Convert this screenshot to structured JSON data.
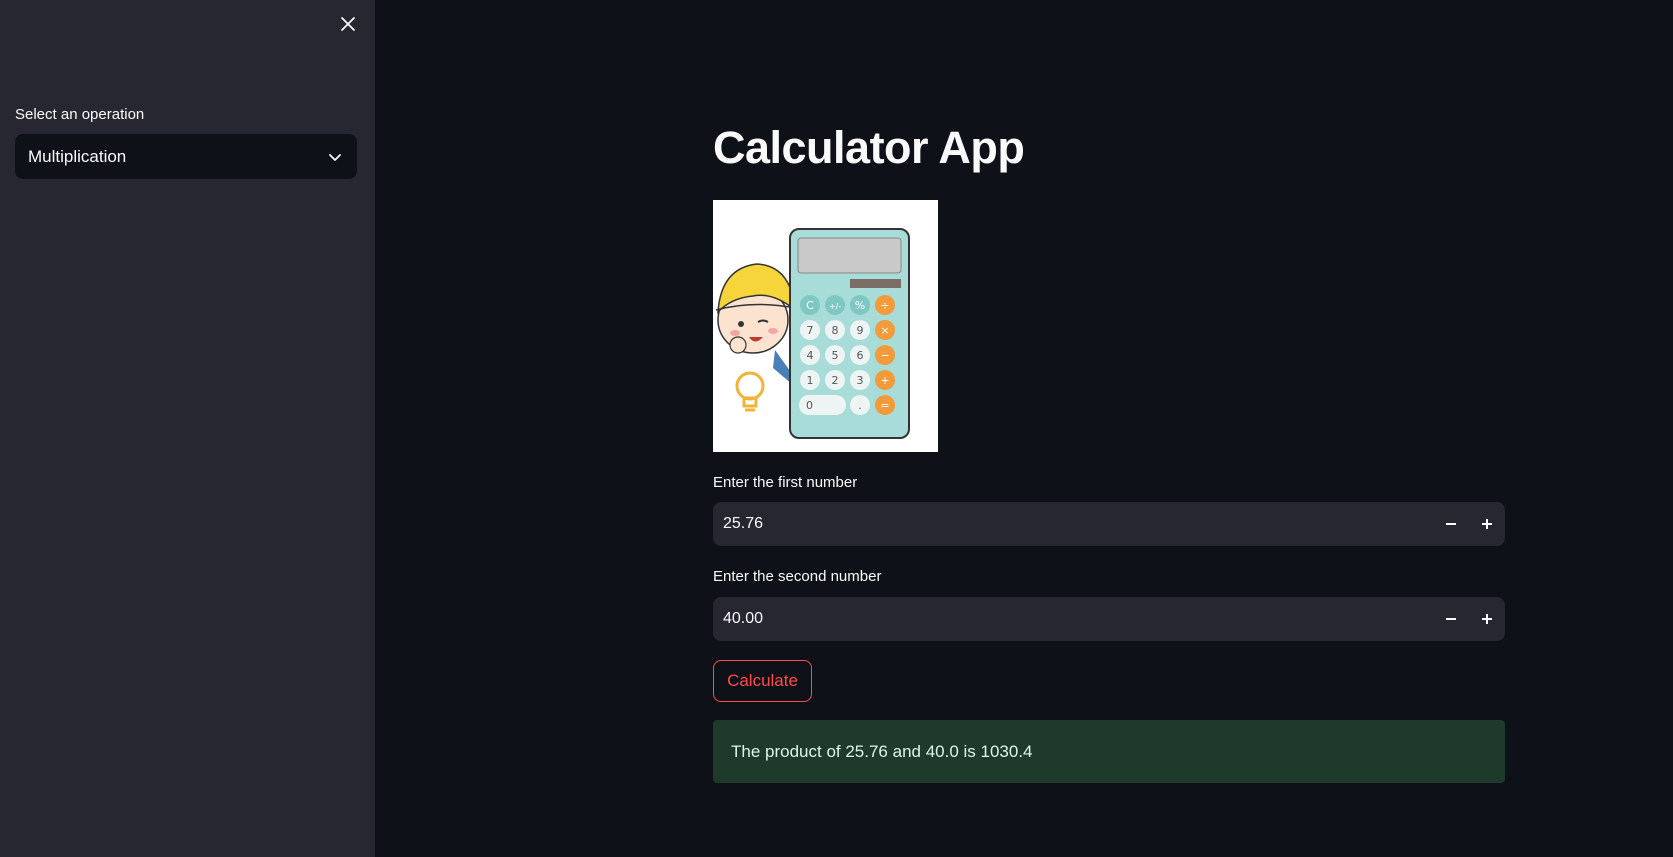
{
  "sidebar": {
    "select_label": "Select an operation",
    "selected_operation": "Multiplication"
  },
  "main": {
    "title": "Calculator App",
    "first_label": "Enter the first number",
    "first_value": "25.76",
    "second_label": "Enter the second number",
    "second_value": "40.00",
    "button_label": "Calculate",
    "result_text": "The product of 25.76 and 40.0 is 1030.4"
  },
  "illustration": {
    "keys": [
      "C",
      "+/-",
      "%",
      "÷",
      "7",
      "8",
      "9",
      "×",
      "4",
      "5",
      "6",
      "−",
      "1",
      "2",
      "3",
      "+",
      "0",
      ".",
      "="
    ]
  },
  "colors": {
    "background": "#0e1117",
    "sidebar": "#262730",
    "input_bg": "#262730",
    "accent": "#ff4b4b",
    "success_bg": "#1d3a2b",
    "calc_body": "#a8dcd9",
    "calc_orange": "#f29b3a"
  },
  "icons": {
    "close": "close-icon",
    "dropdown": "chevron-down-icon",
    "decrement": "minus-icon",
    "increment": "plus-icon"
  }
}
